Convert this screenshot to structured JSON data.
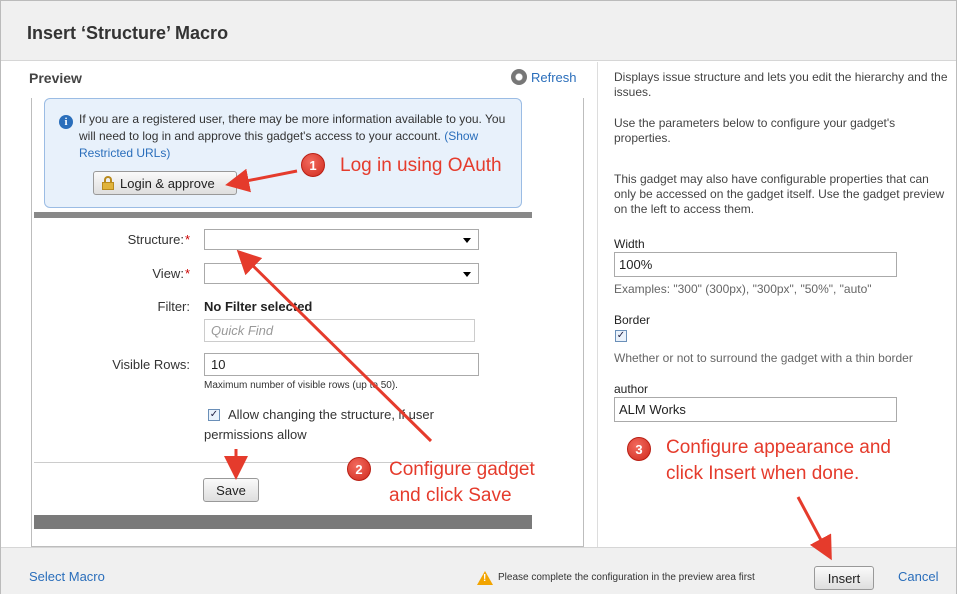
{
  "dialog": {
    "title": "Insert ‘Structure’ Macro"
  },
  "preview": {
    "label": "Preview",
    "refresh": "Refresh",
    "info": {
      "text": "If you are a registered user, there may be more information available to you. You will need to log in and approve this gadget's access to your account.",
      "link": "(Show Restricted URLs)",
      "login_button": "Login & approve"
    },
    "form": {
      "structure_label": "Structure:",
      "view_label": "View:",
      "required_mark": "*",
      "filter_label": "Filter:",
      "filter_value": "No Filter selected",
      "quickfind_placeholder": "Quick Find",
      "visible_rows_label": "Visible Rows:",
      "visible_rows_value": "10",
      "visible_rows_hint": "Maximum number of visible rows (up to 50).",
      "allow_checked": "✓",
      "allow_text": "Allow changing the structure, if user permissions allow",
      "save_button": "Save"
    }
  },
  "sidebar": {
    "desc1": "Displays issue structure and lets you edit the hierarchy and the issues.",
    "desc2": "Use the parameters below to configure your gadget's properties.",
    "desc3": "This gadget may also have configurable properties that can only be accessed on the gadget itself. Use the gadget preview on the left to access them.",
    "width_label": "Width",
    "width_value": "100%",
    "width_hint": "Examples: \"300\" (300px), \"300px\", \"50%\", \"auto\"",
    "border_label": "Border",
    "border_checked": "✓",
    "border_hint": "Whether or not to surround the gadget with a thin border",
    "author_label": "author",
    "author_value": "ALM Works"
  },
  "footer": {
    "select_macro": "Select Macro",
    "warning": "Please complete the configuration in the preview area first",
    "insert_button": "Insert",
    "cancel": "Cancel"
  },
  "callouts": {
    "c1_num": "1",
    "c1_text": "Log in using OAuth",
    "c2_num": "2",
    "c2_line1": "Configure gadget",
    "c2_line2": "and click Save",
    "c3_num": "3",
    "c3_line1": "Configure appearance and",
    "c3_line2": "click Insert when done."
  },
  "colors": {
    "link": "#2a6ebb",
    "callout": "#e53b2c",
    "info_bg": "#e8f1fb"
  },
  "icons": [
    "refresh-icon",
    "info-icon",
    "lock-icon",
    "chevron-down-icon",
    "warning-icon",
    "checkbox-icon"
  ]
}
